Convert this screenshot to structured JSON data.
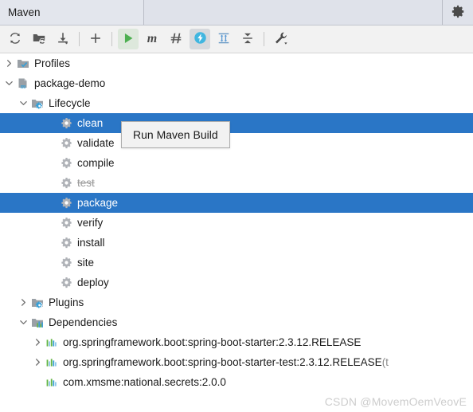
{
  "window": {
    "tab_label": "Maven",
    "settings_icon": "gear-icon"
  },
  "toolbar": {
    "buttons": [
      {
        "name": "reload-projects-button",
        "icon": "refresh-icon",
        "label": "Reload All Maven Projects",
        "state": "normal"
      },
      {
        "name": "generate-sources-button",
        "icon": "folder-refresh-icon",
        "label": "Generate Sources and Update Folders For All Projects",
        "state": "normal"
      },
      {
        "name": "download-sources-button",
        "icon": "download-arrow-icon",
        "label": "Download Sources and/or Documentation",
        "state": "normal"
      },
      {
        "name": "add-maven-project-button",
        "icon": "plus-icon",
        "label": "Add Maven Projects",
        "state": "normal"
      },
      {
        "name": "run-maven-build-button",
        "icon": "run-play-icon",
        "label": "Run Maven Build",
        "state": "active-green"
      },
      {
        "name": "execute-maven-goal-button",
        "icon": "maven-m-icon",
        "label": "Execute Maven Goal",
        "state": "normal"
      },
      {
        "name": "toggle-skip-tests-button",
        "icon": "skip-tests-icon",
        "label": "Toggle 'Skip Tests' Mode",
        "state": "normal"
      },
      {
        "name": "toggle-offline-button",
        "icon": "offline-lightning-icon",
        "label": "Toggle Offline Mode",
        "state": "active-blue"
      },
      {
        "name": "expand-all-button",
        "icon": "expand-all-icon",
        "label": "Expand All",
        "state": "normal"
      },
      {
        "name": "collapse-all-button",
        "icon": "collapse-all-icon",
        "label": "Collapse All",
        "state": "normal"
      },
      {
        "name": "maven-settings-button",
        "icon": "wrench-dropdown-icon",
        "label": "Maven Settings",
        "state": "normal"
      }
    ]
  },
  "tooltip": {
    "text": "Run Maven Build"
  },
  "tree": {
    "nodes": [
      {
        "name": "tree-node-profiles",
        "label": "Profiles",
        "indent": 0,
        "arrow": "collapsed",
        "icon": "folder-check-icon",
        "selected": false,
        "dimmed": false,
        "suffix": ""
      },
      {
        "name": "tree-node-package-demo",
        "label": "package-demo",
        "indent": 0,
        "arrow": "expanded",
        "icon": "maven-module-icon",
        "selected": false,
        "dimmed": false,
        "suffix": ""
      },
      {
        "name": "tree-node-lifecycle",
        "label": "Lifecycle",
        "indent": 1,
        "arrow": "expanded",
        "icon": "folder-gear-icon",
        "selected": false,
        "dimmed": false,
        "suffix": ""
      },
      {
        "name": "tree-node-clean",
        "label": "clean",
        "indent": 3,
        "arrow": "none",
        "icon": "phase-gear-icon",
        "selected": true,
        "dimmed": false,
        "suffix": ""
      },
      {
        "name": "tree-node-validate",
        "label": "validate",
        "indent": 3,
        "arrow": "none",
        "icon": "phase-gear-icon",
        "selected": false,
        "dimmed": false,
        "suffix": ""
      },
      {
        "name": "tree-node-compile",
        "label": "compile",
        "indent": 3,
        "arrow": "none",
        "icon": "phase-gear-icon",
        "selected": false,
        "dimmed": false,
        "suffix": ""
      },
      {
        "name": "tree-node-test",
        "label": "test",
        "indent": 3,
        "arrow": "none",
        "icon": "phase-gear-icon",
        "selected": false,
        "dimmed": true,
        "suffix": ""
      },
      {
        "name": "tree-node-package",
        "label": "package",
        "indent": 3,
        "arrow": "none",
        "icon": "phase-gear-icon",
        "selected": true,
        "dimmed": false,
        "suffix": ""
      },
      {
        "name": "tree-node-verify",
        "label": "verify",
        "indent": 3,
        "arrow": "none",
        "icon": "phase-gear-icon",
        "selected": false,
        "dimmed": false,
        "suffix": ""
      },
      {
        "name": "tree-node-install",
        "label": "install",
        "indent": 3,
        "arrow": "none",
        "icon": "phase-gear-icon",
        "selected": false,
        "dimmed": false,
        "suffix": ""
      },
      {
        "name": "tree-node-site",
        "label": "site",
        "indent": 3,
        "arrow": "none",
        "icon": "phase-gear-icon",
        "selected": false,
        "dimmed": false,
        "suffix": ""
      },
      {
        "name": "tree-node-deploy",
        "label": "deploy",
        "indent": 3,
        "arrow": "none",
        "icon": "phase-gear-icon",
        "selected": false,
        "dimmed": false,
        "suffix": ""
      },
      {
        "name": "tree-node-plugins",
        "label": "Plugins",
        "indent": 1,
        "arrow": "collapsed",
        "icon": "folder-gear-icon",
        "selected": false,
        "dimmed": false,
        "suffix": ""
      },
      {
        "name": "tree-node-dependencies",
        "label": "Dependencies",
        "indent": 1,
        "arrow": "expanded",
        "icon": "folder-bars-icon",
        "selected": false,
        "dimmed": false,
        "suffix": ""
      },
      {
        "name": "tree-node-dependency-spring-boot-starter",
        "label": "org.springframework.boot:spring-boot-starter:2.3.12.RELEASE",
        "indent": 2,
        "arrow": "collapsed",
        "icon": "dependency-bars-icon",
        "selected": false,
        "dimmed": false,
        "suffix": ""
      },
      {
        "name": "tree-node-dependency-spring-boot-starter-test",
        "label": "org.springframework.boot:spring-boot-starter-test:2.3.12.RELEASE",
        "indent": 2,
        "arrow": "collapsed",
        "icon": "dependency-bars-icon",
        "selected": false,
        "dimmed": false,
        "suffix": " (t"
      },
      {
        "name": "tree-node-dependency-national-secrets",
        "label": "com.xmsme:national.secrets:2.0.0",
        "indent": 2,
        "arrow": "none",
        "icon": "dependency-bars-icon",
        "selected": false,
        "dimmed": false,
        "suffix": ""
      }
    ]
  },
  "watermark": {
    "text": "CSDN @MovemOemVeovE"
  },
  "colors": {
    "selection_blue": "#2a76c6",
    "header_bg": "#dfe2ea",
    "toolbar_bg": "#f2f2f2",
    "accent_blue": "#389fd6",
    "run_green": "#59a869",
    "dimmed_text": "#9b9b9b"
  }
}
